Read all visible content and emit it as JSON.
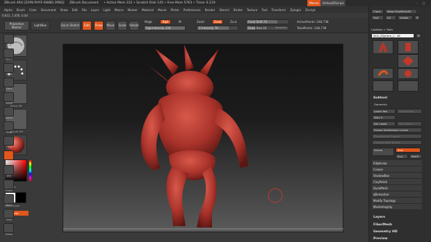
{
  "window": {
    "title": "ZBrush 4R4 [Z2P8-PHYF-6W8D-3P8Q]",
    "doc": "ZBrush Document",
    "stats": "• Active Mem 312 • Scratch Disk 145 • Free Mem 5763 • Timer 0.219",
    "menus_label": "Menus",
    "script_label": "DefaultZScript"
  },
  "menubar": [
    "Alpha",
    "Brush",
    "Color",
    "Document",
    "Draw",
    "Edit",
    "File",
    "Layer",
    "Light",
    "Macro",
    "Marker",
    "Material",
    "Movie",
    "Picker",
    "Preferences",
    "Render",
    "Stencil",
    "Stroke",
    "Texture",
    "Tool",
    "Transform",
    "Zplugin",
    "Zscript"
  ],
  "status_coords": "0.631, 1.456, 0.44",
  "toolbar": {
    "projection_master": "Projection Master",
    "lightbox": "LightBox",
    "quick_sketch": "Quick Sketch",
    "edit": "Edit",
    "draw": "Draw",
    "move": "Move",
    "scale": "Scale",
    "rotate": "Rotate",
    "mrgb": "Mrgb",
    "rgb": "Rgb",
    "m": "M",
    "rgb_intensity": "Rgb Intensity 100",
    "zadd": "Zadd",
    "zsub": "Zsub",
    "zcut": "Zcut",
    "z_intensity": "Z Intensity 78",
    "focal_shift": "Focal Shift 74",
    "draw_size": "Draw Size 22",
    "dynamic": "Dynamic",
    "active_points": "ActivePoints: 248,738",
    "total_points": "TotalPoints: 248,738"
  },
  "leftshelf": {
    "cap1": "SkinShade4",
    "cap2": "Alpha Off",
    "cap3": "Texture Off",
    "gradient": "Gradient",
    "switch": "SwitchColor",
    "alternate": "Alternate"
  },
  "rightshelf": [
    "BPR",
    "SPix 3",
    "Scroll",
    "Zoom",
    "Actual",
    "AAHalf",
    "Persp",
    "Floor",
    "Local",
    "L.Sym",
    "XYZ",
    "Frame",
    "Move",
    "Scale",
    "Rotate",
    "Line Fill",
    "PolyF",
    "Transp",
    "Dynamic",
    "Solo"
  ],
  "tray": {
    "clone": "Clone",
    "make_polymesh": "Make PolyMesh3D",
    "go_z": "GoZ",
    "all": "All",
    "visible": "Visible",
    "r": "R",
    "lightbox_tools": "Lightbox > Tools",
    "skin_zsphere": "Skin_ZSphere_1 . 48",
    "r2": "R",
    "tools": [
      "Skin_ZSphe",
      "Cylinder3D",
      "PolyMesh3D",
      "SimpleBrush",
      "ZSphere",
      "Skin_ZSphe",
      "ZSphere_1"
    ],
    "subtool": "Subtool",
    "geometry": "Geometry",
    "lower_res": "Lower Res",
    "higher_res": "Higher Res",
    "sdiv": "SDiv 5",
    "del_lower": "Del Lower",
    "del_higher": "Del Higher",
    "freeze": "Freeze SubDivision Levels",
    "reconstruct": "Reconstruct Subdiv",
    "convert_bpr": "Convert BPR To Geo",
    "divide": "Divide",
    "smt": "Smt",
    "suv": "Suv",
    "rsuv": "ReUV",
    "items": [
      "EdgeLoop",
      "Crease",
      "ShadowBox",
      "ClayPolish",
      "DynaMesh",
      "qRemesher",
      "Modify Topology",
      "MeshIntegrity"
    ],
    "layers": "Layers",
    "fibermesh": "FiberMesh",
    "geometry_hd": "Geometry HD",
    "preview": "Preview"
  },
  "colors": {
    "accent": "#e2561c",
    "model": "#b3362b",
    "panel": "#3a3a3a"
  }
}
